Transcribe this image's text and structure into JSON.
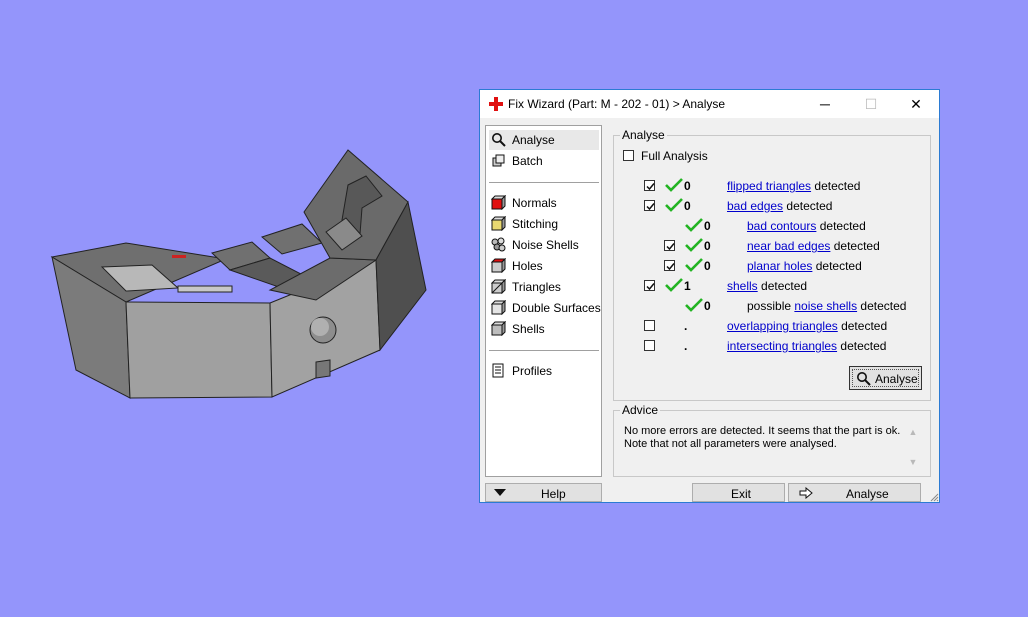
{
  "window": {
    "title": "Fix Wizard (Part: M - 202 - 01) > Analyse",
    "minimize_glyph": "─",
    "maximize_glyph": "☐",
    "close_glyph": "✕"
  },
  "nav": {
    "top_items": [
      {
        "label": "Analyse",
        "icon": "magnifier-icon"
      },
      {
        "label": "Batch",
        "icon": "batch-icon"
      }
    ],
    "fix_items": [
      {
        "label": "Normals",
        "icon": "normals-cube-icon"
      },
      {
        "label": "Stitching",
        "icon": "stitching-cube-icon"
      },
      {
        "label": "Noise Shells",
        "icon": "noise-shells-icon"
      },
      {
        "label": "Holes",
        "icon": "holes-cube-icon"
      },
      {
        "label": "Triangles",
        "icon": "triangles-cube-icon"
      },
      {
        "label": "Double Surfaces",
        "icon": "double-surfaces-icon"
      },
      {
        "label": "Shells",
        "icon": "shells-cube-icon"
      }
    ],
    "profiles": {
      "label": "Profiles",
      "icon": "profiles-icon"
    }
  },
  "analyse": {
    "group_label": "Analyse",
    "full_analysis_label": "Full Analysis",
    "full_analysis_checked": false,
    "detected_word": "detected",
    "rows": [
      {
        "checked": true,
        "ok": true,
        "value": "0",
        "link": "flipped triangles",
        "prefix": ""
      },
      {
        "checked": true,
        "ok": true,
        "value": "0",
        "link": "bad edges",
        "prefix": ""
      },
      {
        "checked": null,
        "ok": true,
        "value": "0",
        "link": "bad contours",
        "prefix": ""
      },
      {
        "checked": true,
        "ok": true,
        "value": "0",
        "link": "near bad edges",
        "prefix": ""
      },
      {
        "checked": true,
        "ok": true,
        "value": "0",
        "link": "planar holes",
        "prefix": ""
      },
      {
        "checked": true,
        "ok": true,
        "value": "1",
        "link": "shells",
        "prefix": ""
      },
      {
        "checked": null,
        "ok": true,
        "value": "0",
        "link": "noise shells",
        "prefix": "possible"
      },
      {
        "checked": false,
        "ok": false,
        "value": ".",
        "link": "overlapping triangles",
        "prefix": ""
      },
      {
        "checked": false,
        "ok": false,
        "value": ".",
        "link": "intersecting triangles",
        "prefix": ""
      }
    ],
    "button_label": "Analyse"
  },
  "advice": {
    "group_label": "Advice",
    "text": "No more errors are detected. It seems that the part is ok. Note that not all parameters were analysed."
  },
  "footer": {
    "help_label": "Help",
    "exit_label": "Exit",
    "analyse_label": "Analyse"
  },
  "colors": {
    "background": "#9495fb",
    "check_green": "#22b422",
    "link_blue": "#0000cc",
    "model_gray": "#9e9e9e"
  }
}
